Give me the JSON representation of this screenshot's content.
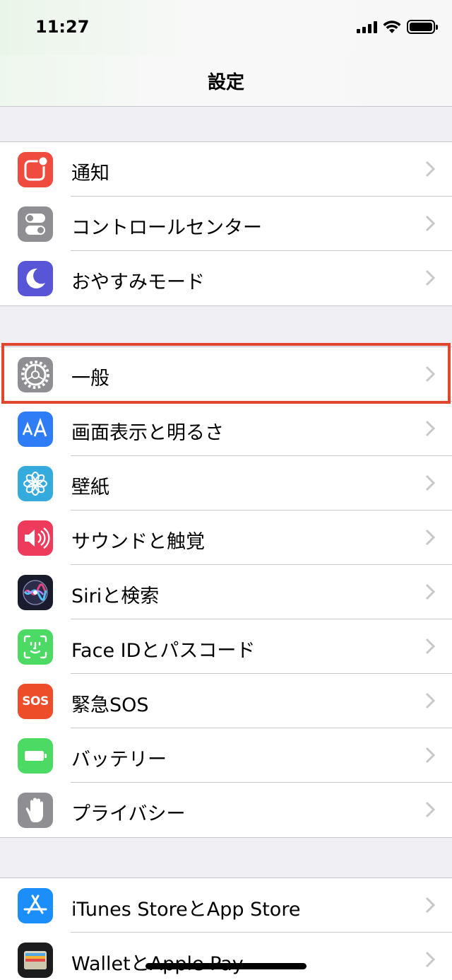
{
  "status_bar": {
    "time": "11:27"
  },
  "nav": {
    "title": "設定"
  },
  "groups": [
    {
      "items": [
        {
          "label": "通知",
          "icon": "notifications-icon",
          "color": "#ef4b3f"
        },
        {
          "label": "コントロールセンター",
          "icon": "control-center-icon",
          "color": "#8e8e93"
        },
        {
          "label": "おやすみモード",
          "icon": "moon-icon",
          "color": "#5856d6"
        }
      ]
    },
    {
      "items": [
        {
          "label": "一般",
          "icon": "gear-icon",
          "color": "#8e8e93",
          "highlighted": true
        },
        {
          "label": "画面表示と明るさ",
          "icon": "display-text-icon",
          "color": "#2e7cf6"
        },
        {
          "label": "壁紙",
          "icon": "flower-icon",
          "color": "#35aadc"
        },
        {
          "label": "サウンドと触覚",
          "icon": "speaker-icon",
          "color": "#ee3b5b"
        },
        {
          "label": "Siriと検索",
          "icon": "siri-icon",
          "color": "#1b1b2e"
        },
        {
          "label": "Face IDとパスコード",
          "icon": "face-id-icon",
          "color": "#4cd964"
        },
        {
          "label": "緊急SOS",
          "icon": "sos-icon",
          "color": "#ee4d2a",
          "icon_text": "SOS"
        },
        {
          "label": "バッテリー",
          "icon": "battery-icon",
          "color": "#4cd964"
        },
        {
          "label": "プライバシー",
          "icon": "hand-icon",
          "color": "#8e8e93"
        }
      ]
    },
    {
      "items": [
        {
          "label": "iTunes StoreとApp Store",
          "icon": "app-store-icon",
          "color": "#1c8ef9"
        },
        {
          "label": "WalletとApple Pay",
          "icon": "wallet-icon",
          "color": "#1c1c1e"
        }
      ]
    }
  ]
}
